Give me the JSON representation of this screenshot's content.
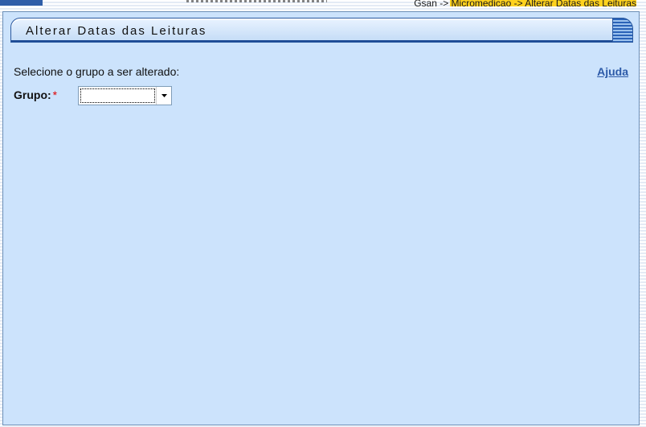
{
  "header": {
    "breadcrumb": "Gsan -> Micromedicao -> Alterar Datas das Leituras"
  },
  "panel": {
    "title": "Alterar Datas das Leituras",
    "prompt": "Selecione o grupo a ser alterado:",
    "help_link": "Ajuda",
    "group_field": {
      "label": "Grupo:",
      "required_mark": "*",
      "selected_value": ""
    }
  },
  "colors": {
    "panel_bg": "#cce3fc",
    "title_border": "#2c5aa0",
    "link": "#2c5aa8",
    "required": "#e00000",
    "breadcrumb_highlight": "#ffd21e"
  },
  "icons": {
    "select_arrow": "chevron-down-icon"
  }
}
